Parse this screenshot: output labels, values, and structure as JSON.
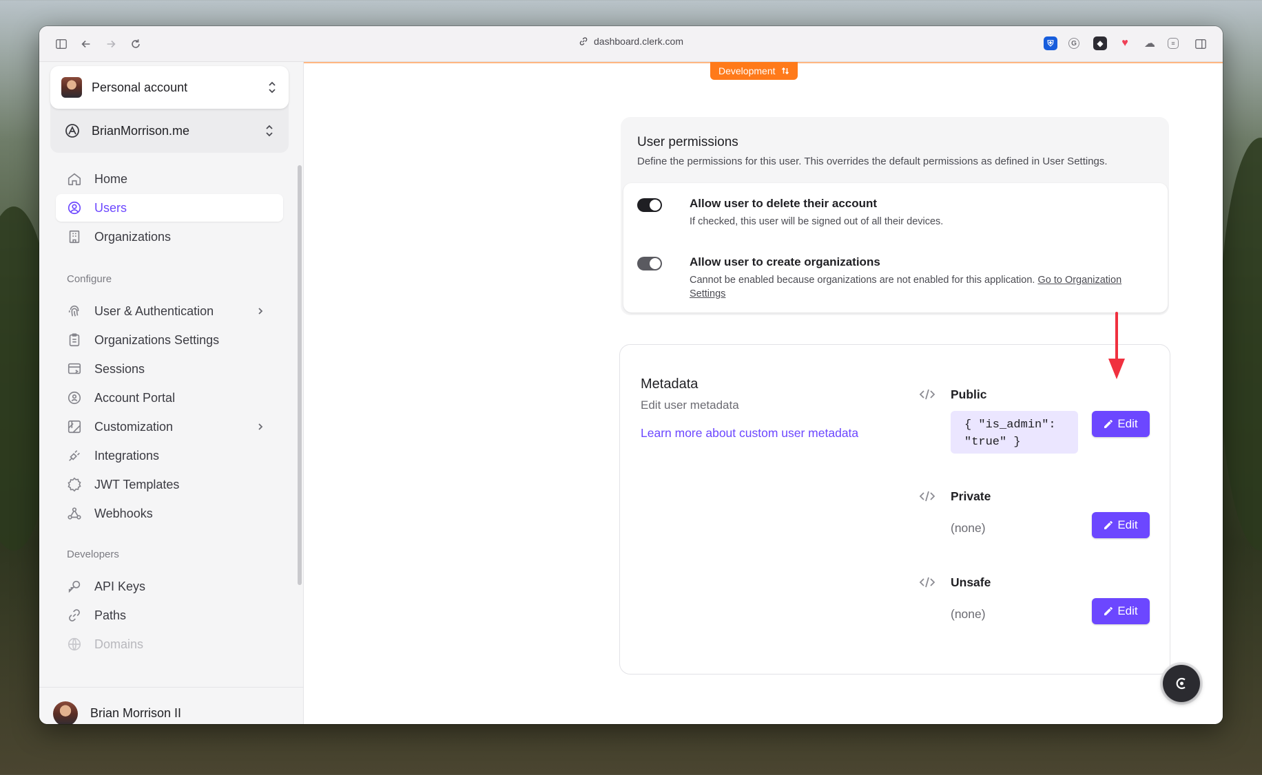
{
  "browser": {
    "url": "dashboard.clerk.com"
  },
  "sidebar": {
    "account_switcher": "Personal account",
    "app_switcher": "BrianMorrison.me",
    "items": [
      {
        "label": "Home",
        "icon": "home-icon"
      },
      {
        "label": "Users",
        "icon": "user-circle-icon",
        "active": true
      },
      {
        "label": "Organizations",
        "icon": "building-icon"
      }
    ],
    "configure_label": "Configure",
    "configure_items": [
      {
        "label": "User & Authentication",
        "icon": "fingerprint-icon",
        "expandable": true
      },
      {
        "label": "Organizations Settings",
        "icon": "clipboard-icon"
      },
      {
        "label": "Sessions",
        "icon": "session-window-icon"
      },
      {
        "label": "Account Portal",
        "icon": "portal-icon"
      },
      {
        "label": "Customization",
        "icon": "palette-icon",
        "expandable": true
      },
      {
        "label": "Integrations",
        "icon": "plug-icon"
      },
      {
        "label": "JWT Templates",
        "icon": "badge-icon"
      },
      {
        "label": "Webhooks",
        "icon": "webhook-icon"
      }
    ],
    "developers_label": "Developers",
    "developer_items": [
      {
        "label": "API Keys",
        "icon": "key-icon"
      },
      {
        "label": "Paths",
        "icon": "link-icon"
      },
      {
        "label": "Domains",
        "icon": "globe-icon"
      }
    ],
    "user_name": "Brian Morrison II"
  },
  "main": {
    "env_badge": "Development",
    "permissions": {
      "title": "User permissions",
      "subtitle": "Define the permissions for this user. This overrides the default permissions as defined in User Settings.",
      "items": [
        {
          "label": "Allow user to delete their account",
          "description": "If checked, this user will be signed out of all their devices.",
          "enabled": true
        },
        {
          "label": "Allow user to create organizations",
          "description": "Cannot be enabled because organizations are not enabled for this application.",
          "link": "Go to Organization Settings",
          "enabled": true,
          "disabled": true
        }
      ]
    },
    "metadata": {
      "title": "Metadata",
      "subtitle": "Edit user metadata",
      "learn_more": "Learn more about custom user metadata",
      "public_label": "Public",
      "public_value_line1": "{ \"is_admin\":",
      "public_value_line2": "\"true\" }",
      "private_label": "Private",
      "private_value": "(none)",
      "unsafe_label": "Unsafe",
      "unsafe_value": "(none)",
      "edit_label": "Edit"
    }
  },
  "colors": {
    "accent": "#6c47ff",
    "dev_badge": "#ff7a1a",
    "annotation_arrow": "#f0303f"
  }
}
